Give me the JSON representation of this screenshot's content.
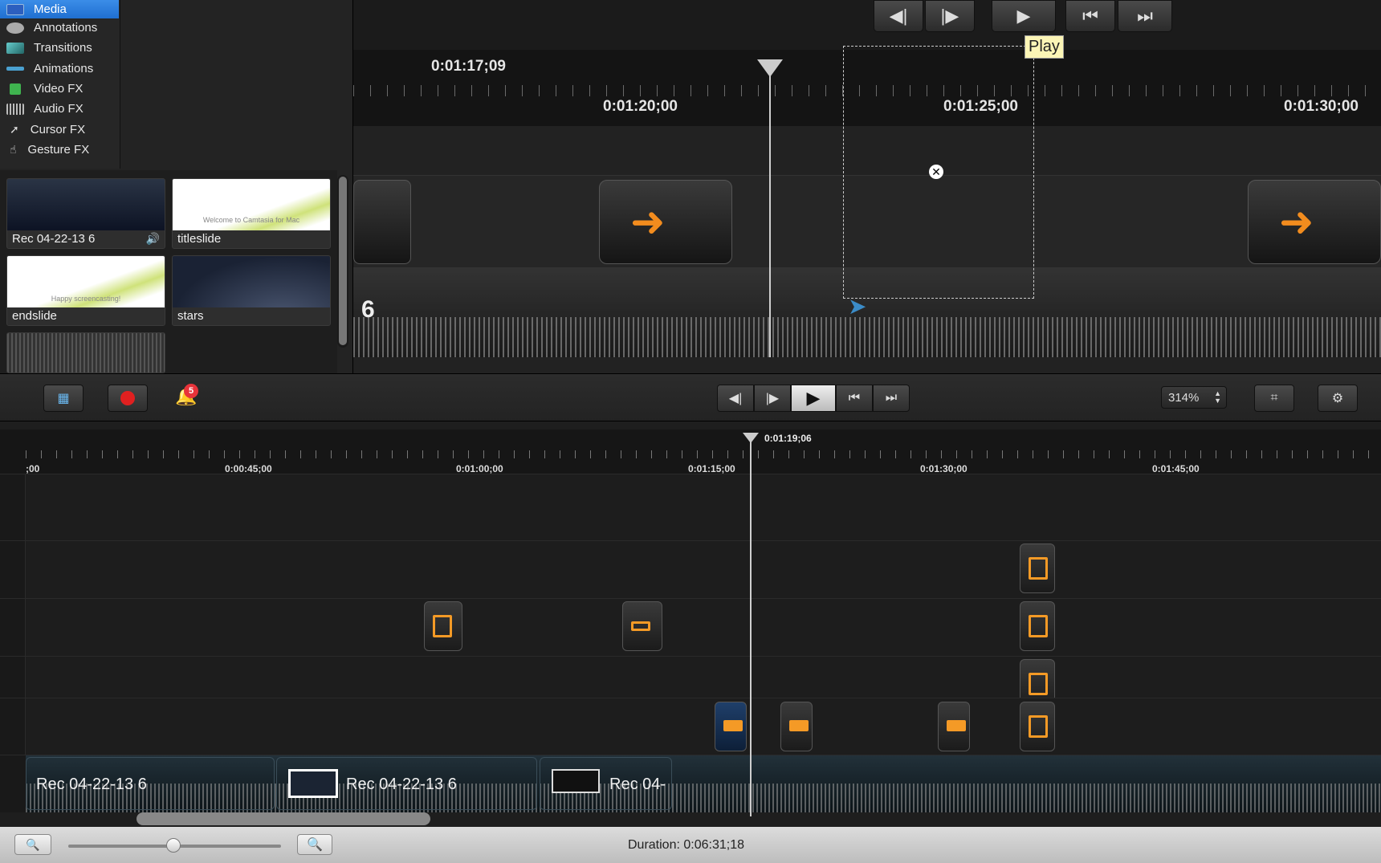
{
  "library": {
    "items": [
      {
        "label": "Media",
        "icon": "media-icon",
        "color": "#3b6bc9",
        "selected": true
      },
      {
        "label": "Annotations",
        "icon": "annotations-icon",
        "color": "#b0b0b0"
      },
      {
        "label": "Transitions",
        "icon": "transitions-icon",
        "color": "#4aa9a0"
      },
      {
        "label": "Animations",
        "icon": "animations-icon",
        "color": "#4aa0d0"
      },
      {
        "label": "Video FX",
        "icon": "videofx-icon",
        "color": "#3fb34f"
      },
      {
        "label": "Audio FX",
        "icon": "audiofx-icon",
        "color": "#bbbbbb"
      },
      {
        "label": "Cursor FX",
        "icon": "cursor-icon",
        "color": "#dddddd"
      },
      {
        "label": "Gesture FX",
        "icon": "gesture-icon",
        "color": "#dddddd"
      }
    ]
  },
  "media": {
    "items": [
      {
        "label": "Rec 04-22-13 6",
        "caption": ""
      },
      {
        "label": "titleslide",
        "caption": "Welcome to Camtasia for Mac"
      },
      {
        "label": "endslide",
        "caption": "Happy screencasting!"
      },
      {
        "label": "stars",
        "caption": ""
      }
    ]
  },
  "canvas": {
    "playhead_time": "0:01:17;09",
    "ruler_labels": [
      "0:01:20;00",
      "0:01:25;00",
      "0:01:30;00"
    ],
    "tooltip": "Play",
    "track_number": "6"
  },
  "toolbar": {
    "zoom_value": "314%",
    "notifications_count": "5"
  },
  "timeline": {
    "playhead_time": "0:01:19;06",
    "ruler_labels": [
      ";00",
      "0:00:45;00",
      "0:01:00;00",
      "0:01:15;00",
      "0:01:30;00",
      "0:01:45;00"
    ],
    "media_clips": [
      "Rec 04-22-13 6",
      "Rec 04-22-13 6",
      "Rec 04-"
    ]
  },
  "status": {
    "duration": "Duration: 0:06:31;18"
  }
}
